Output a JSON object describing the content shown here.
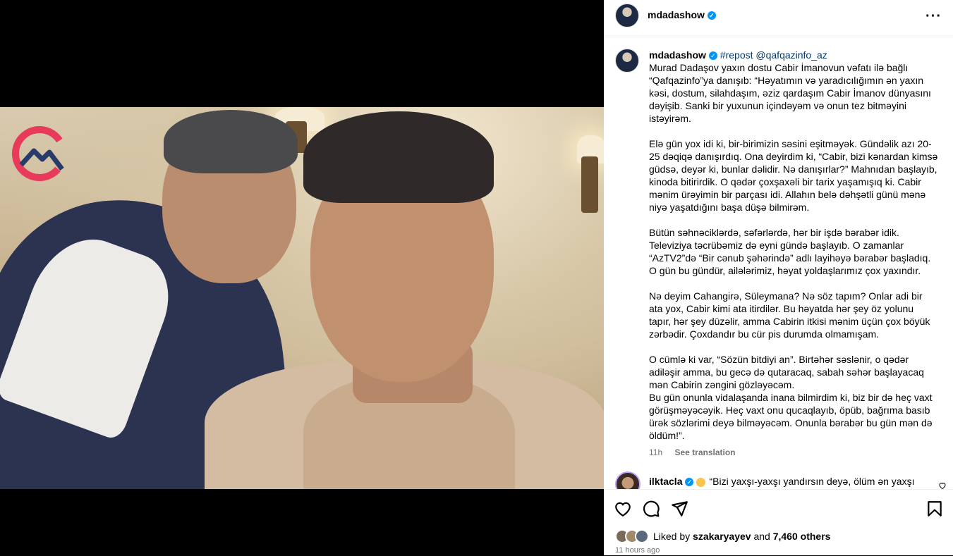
{
  "header": {
    "username": "mdadashow",
    "more_icon": "more-horizontal-icon"
  },
  "caption": {
    "username": "mdadashow",
    "repost": "#repost",
    "mention": "@qafqazinfo_az",
    "text": "Murad Dadaşov yaxın dostu Cabir İmanovun vəfatı ilə bağlı “Qafqazinfo”ya danışıb: “Həyatımın və yaradıcılığımın ən yaxın kəsi, dostum, silahdaşım, əziz qardaşım Cabir İmanov dünyasını dəyişib. Sanki bir yuxunun içindəyəm və onun tez bitməyini istəyirəm.\n\nElə gün yox idi ki, bir-birimizin səsini eşitməyək. Gündəlik azı 20-25 dəqiqə danışırdıq. Ona deyirdim ki, “Cabir, bizi kənardan kimsə güdsə, deyər ki, bunlar dəlidir. Nə danışırlar?” Mahnıdan başlayıb, kinoda bitirirdik. O qədər çoxşaxəli bir tarix yaşamışıq ki. Cabir mənim ürəyimin bir parçası idi. Allahın belə dəhşətli günü mənə niyə yaşatdığını başa düşə bilmirəm.\n\nBütün səhnəciklərdə, səfərlərdə, hər bir işdə bərabər idik. Televiziya təcrübəmiz də eyni gündə başlayıb. O zamanlar “AzTV2”də “Bir cənub şəhərində” adlı layihəyə bərabər başladıq. O gün bu gündür, ailələrimiz, həyat yoldaşlarımız çox yaxındır.\n\nNə deyim Cahangirə, Süleymana? Nə söz tapım? Onlar adi bir ata yox, Cabir kimi ata itirdilər. Bu həyatda hər şey öz yolunu tapır, hər şey düzəlir, amma Cabirin itkisi mənim üçün çox böyük zərbədir. Çoxdandır bu cür pis durumda olmamışam.\n\nO cümlə ki var, “Sözün bitdiyi an”. Birtəhər səslənir, o qədər adiləşir amma, bu gecə də qutaracaq, sabah səhər başlayacaq mən Cabirin zəngini gözləyəcəm.\nBu gün onunla vidalaşanda inana bilmirdim ki, biz bir də heç vaxt görüşməyəcəyik. Heç vaxt onu qucaqlayıb, öpüb, bağrıma basıb ürək sözlərimi deyə bilməyəcəm. Onunla bərabər bu gün mən də öldüm!”.",
    "age": "11h",
    "see_translation": "See translation"
  },
  "comment": {
    "username": "ilktacla",
    "text": "“Bizi yaxşı-yaxşı yandırsın deyə, ölüm ən yaxşı"
  },
  "likes": {
    "prefix": "Liked by",
    "user": "szakaryayev",
    "joiner": "and",
    "count": "7,460 others"
  },
  "time_ago": "11 hours ago",
  "icons": [
    "heart-icon",
    "comment-icon",
    "share-icon",
    "bookmark-icon"
  ]
}
